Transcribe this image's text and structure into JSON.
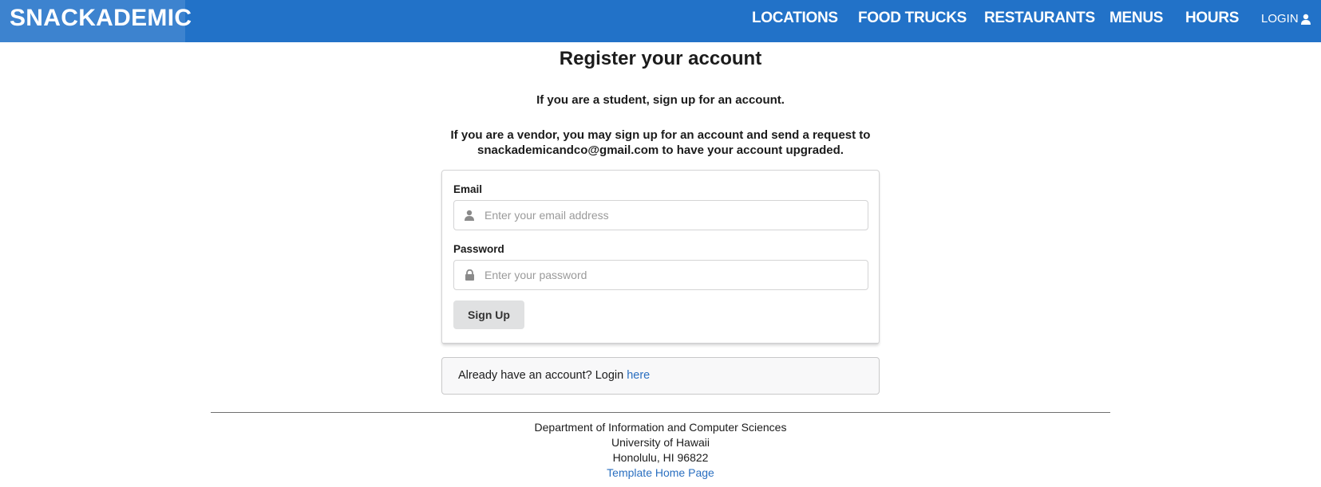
{
  "navbar": {
    "brand": "SNACKADEMIC",
    "links": [
      "LOCATIONS",
      "FOOD TRUCKS",
      "RESTAURANTS",
      "MENUS",
      "HOURS"
    ],
    "login": "LOGIN",
    "colors": {
      "bar": "#2272c8",
      "brand_bg": "#3d83cf"
    }
  },
  "main": {
    "title": "Register your account",
    "student_note": "If you are a student, sign up for an account.",
    "vendor_note_line1": "If you are a vendor, you may sign up for an account and send a request to",
    "vendor_note_line2": "snackademicandco@gmail.com to have your account upgraded."
  },
  "form": {
    "email_label": "Email",
    "email_placeholder": "Enter your email address",
    "email_icon": "user-icon",
    "password_label": "Password",
    "password_placeholder": "Enter your password",
    "password_icon": "lock-icon",
    "submit_label": "Sign Up"
  },
  "login_message": {
    "text": "Already have an account? Login ",
    "link": "here"
  },
  "footer": {
    "line1": "Department of Information and Computer Sciences",
    "line2": "University of Hawaii",
    "line3": "Honolulu, HI 96822",
    "link": "Template Home Page"
  }
}
